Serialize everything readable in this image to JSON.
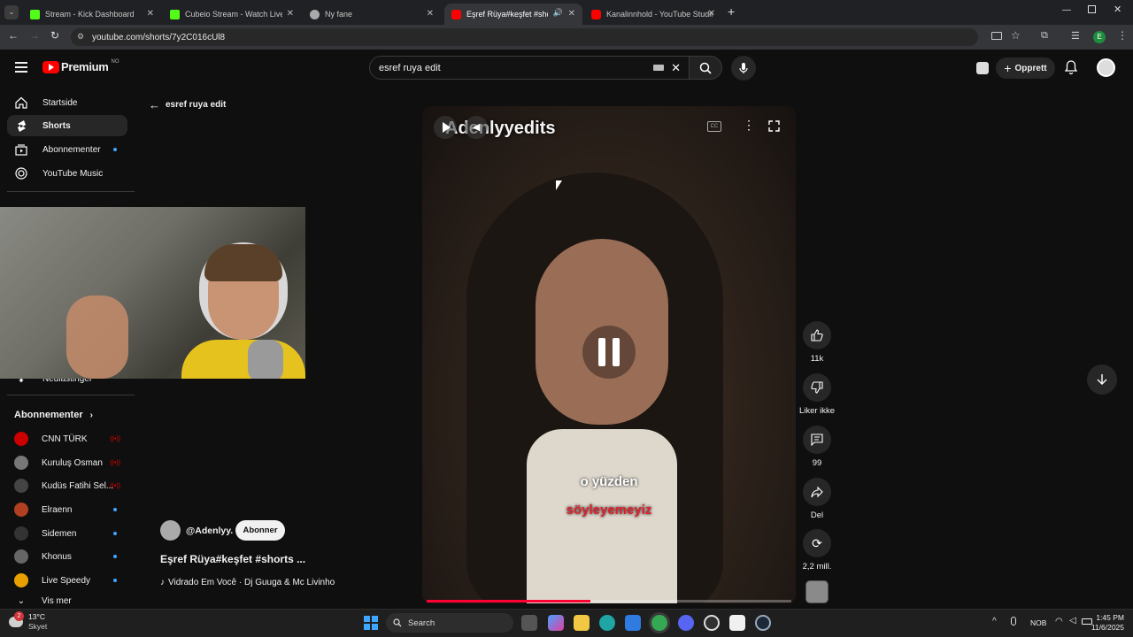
{
  "browser": {
    "tabs": [
      {
        "label": "Stream - Kick Dashboard",
        "color": "#53fc18",
        "icon": "kick-icon"
      },
      {
        "label": "Cubeio Stream - Watch Live on",
        "color": "#53fc18",
        "icon": "kick-icon"
      },
      {
        "label": "Ny fane",
        "color": "#aaaaaa",
        "icon": "chrome-icon"
      },
      {
        "label": "Eşref Rüya#keşfet #shorts",
        "color": "#ff0000",
        "icon": "youtube-icon"
      },
      {
        "label": "Kanalinnhold - YouTube Studio",
        "color": "#ff0000",
        "icon": "youtube-studio-icon"
      }
    ],
    "url": "youtube.com/shorts/7y2C016cUl8",
    "profile_initial": "E"
  },
  "youtube": {
    "logo_text": "Premium",
    "region": "NO",
    "search_value": "esref ruya edit",
    "create_label": "Opprett",
    "back_label": "esref ruya edit"
  },
  "sidebar": {
    "items": [
      {
        "label": "Startside",
        "icon": "home-icon"
      },
      {
        "label": "Shorts",
        "icon": "shorts-icon"
      },
      {
        "label": "Abonnementer",
        "icon": "subscriptions-icon"
      },
      {
        "label": "YouTube Music",
        "icon": "youtube-music-icon"
      }
    ],
    "hidden_item": "Nedlastinger",
    "subs_heading": "Abonnementer",
    "subscriptions": [
      {
        "name": "CNN TÜRK",
        "badge": "live",
        "color": "#cc0000"
      },
      {
        "name": "Kuruluş Osman",
        "badge": "live",
        "color": "#777777"
      },
      {
        "name": "Kudüs Fatihi Sel...",
        "badge": "live",
        "color": "#444444"
      },
      {
        "name": "Elraenn",
        "badge": "dot",
        "color": "#b04020"
      },
      {
        "name": "Sidemen",
        "badge": "dot",
        "color": "#333333"
      },
      {
        "name": "Khonus",
        "badge": "dot",
        "color": "#666666"
      },
      {
        "name": "Live Speedy",
        "badge": "dot",
        "color": "#e8a000"
      }
    ],
    "show_more": "Vis mer"
  },
  "short": {
    "watermark": "Adenlyyedits",
    "caption_top": "o yüzden",
    "caption_bottom": "söyleyemeyiz",
    "channel": "@Adenlyy.",
    "subscribe_label": "Abonner",
    "title": "Eşref Rüya#keşfet #shorts ...",
    "music": "Vidrado Em Você · Dj Guuga & Mc Livinho",
    "progress": 0.45
  },
  "actions": [
    {
      "label": "11k",
      "icon": "like-icon"
    },
    {
      "label": "Liker ikke",
      "icon": "dislike-icon"
    },
    {
      "label": "99",
      "icon": "comment-icon"
    },
    {
      "label": "Del",
      "icon": "share-icon"
    },
    {
      "label": "2,2 mill.",
      "icon": "remix-icon"
    }
  ],
  "taskbar": {
    "weather_temp": "13°C",
    "weather_desc": "Skyet",
    "weather_badge": "2",
    "search_label": "Search",
    "lang": "NOB",
    "time": "1:45 PM",
    "date": "11/6/2025"
  }
}
